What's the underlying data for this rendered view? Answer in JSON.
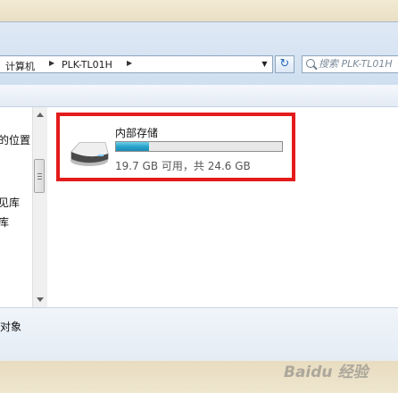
{
  "address_bar": {
    "breadcrumbs": [
      "计算机",
      "PLK-TL01H"
    ]
  },
  "search": {
    "placeholder": "搜索 PLK-TL01H"
  },
  "nav_pane": {
    "items": [
      "的位置",
      "见库",
      "库"
    ]
  },
  "drive": {
    "name": "内部存储",
    "free_text": "19.7 GB 可用，共 24.6 GB",
    "used_fraction": 0.2
  },
  "details": {
    "status": "对象"
  },
  "watermark": {
    "text": "Baidu 经验"
  },
  "colors": {
    "highlight_border": "#e41b1b",
    "bar_fill": "#24a0c8"
  }
}
